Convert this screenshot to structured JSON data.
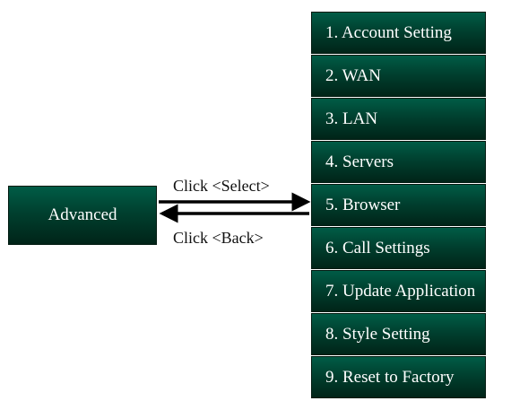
{
  "advanced_box": {
    "label": "Advanced"
  },
  "arrows": {
    "select_label": "Click <Select>",
    "back_label": "Click <Back>"
  },
  "menu": {
    "items": [
      {
        "label": "1. Account Setting"
      },
      {
        "label": "2. WAN"
      },
      {
        "label": "3. LAN"
      },
      {
        "label": "4. Servers"
      },
      {
        "label": "5. Browser"
      },
      {
        "label": "6. Call Settings"
      },
      {
        "label": "7. Update Application"
      },
      {
        "label": "8. Style Setting"
      },
      {
        "label": "9. Reset to Factory"
      }
    ]
  },
  "colors": {
    "box_fill_top": "#005c46",
    "box_fill_bottom": "#002418",
    "box_text": "#ffffff",
    "arrow": "#000000",
    "background": "#ffffff"
  }
}
